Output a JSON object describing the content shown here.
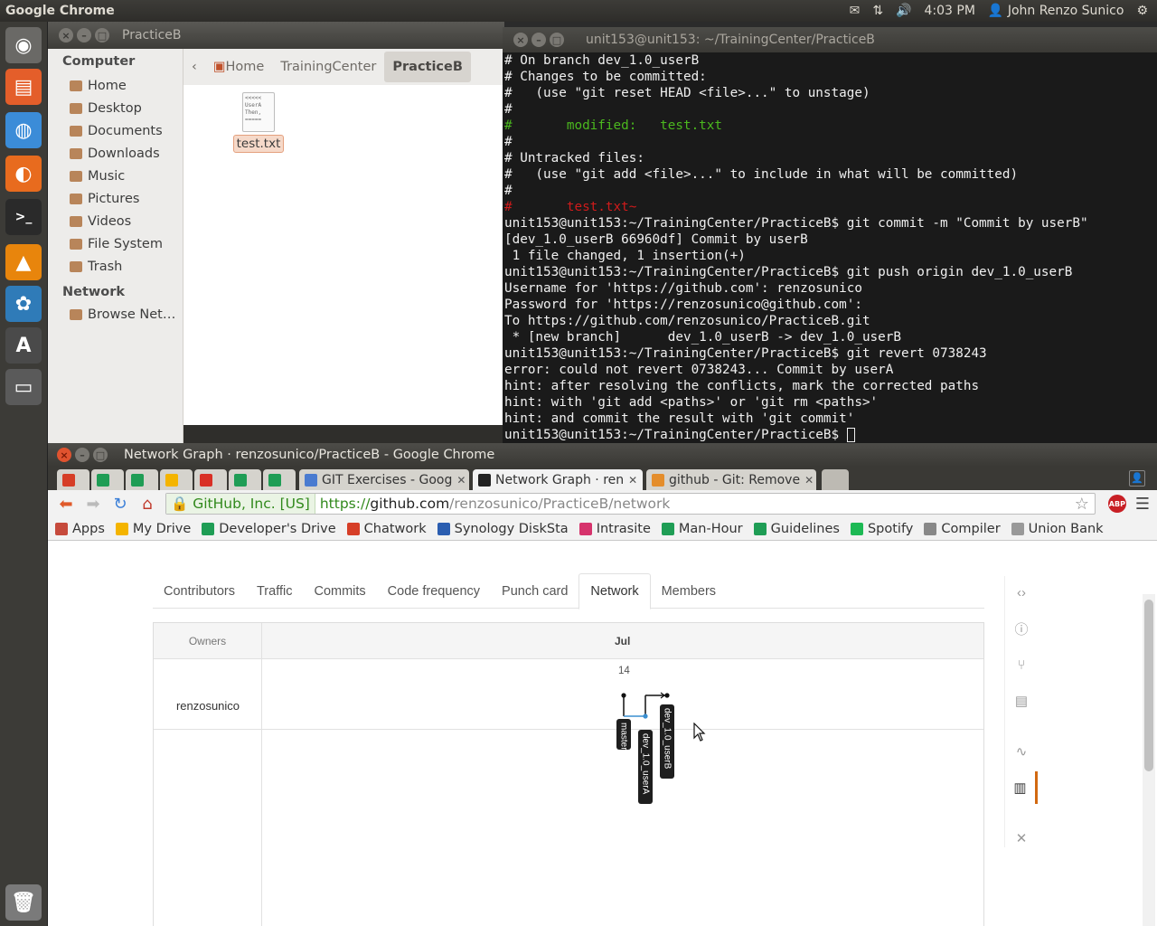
{
  "topbar": {
    "app_name": "Google Chrome",
    "time": "4:03 PM",
    "user": "John Renzo Sunico",
    "mail_icon": "✉",
    "network_icon": "⇅",
    "volume_icon": "🔊",
    "user_icon": "👤",
    "settings_icon": "⚙"
  },
  "launcher": {
    "items": [
      {
        "name": "ubuntu-dash-icon",
        "glyph": "◉",
        "color": "#6a6966"
      },
      {
        "name": "files-icon",
        "glyph": "▤",
        "color": "#e45e2a"
      },
      {
        "name": "chrome-icon",
        "glyph": "◍",
        "color": "#3b8cd8"
      },
      {
        "name": "firefox-icon",
        "glyph": "◐",
        "color": "#e86b1e"
      },
      {
        "name": "terminal-icon",
        "glyph": ">_",
        "color": "#2a2a2a"
      },
      {
        "name": "vlc-icon",
        "glyph": "▲",
        "color": "#e8850c"
      },
      {
        "name": "app-icon",
        "glyph": "✿",
        "color": "#2f7bb8"
      },
      {
        "name": "font-viewer-icon",
        "glyph": "A",
        "color": "#4a4a4a"
      },
      {
        "name": "window-icon",
        "glyph": "▭",
        "color": "#5a5a5a"
      },
      {
        "name": "trash-icon",
        "glyph": "🗑",
        "color": "#7a7a7a"
      }
    ]
  },
  "file_manager": {
    "title": "PracticeB",
    "sidebar_computer": "Computer",
    "sidebar_network": "Network",
    "places": [
      "Home",
      "Desktop",
      "Documents",
      "Downloads",
      "Music",
      "Pictures",
      "Videos",
      "File System",
      "Trash"
    ],
    "network_places": [
      "Browse Net…"
    ],
    "breadcrumbs": [
      "Home",
      "TrainingCenter",
      "PracticeB"
    ],
    "file_name": "test.txt",
    "file_preview": "<<<<<\nUserA\nThen,\n=====",
    "crumb_back": "‹"
  },
  "terminal": {
    "title": "unit153@unit153: ~/TrainingCenter/PracticeB",
    "lines": [
      {
        "text": "# On branch dev_1.0_userB",
        "cls": ""
      },
      {
        "text": "# Changes to be committed:",
        "cls": ""
      },
      {
        "text": "#   (use \"git reset HEAD <file>...\" to unstage)",
        "cls": ""
      },
      {
        "text": "#",
        "cls": ""
      },
      {
        "text": "#       modified:   test.txt",
        "cls": "grn"
      },
      {
        "text": "#",
        "cls": ""
      },
      {
        "text": "# Untracked files:",
        "cls": ""
      },
      {
        "text": "#   (use \"git add <file>...\" to include in what will be committed)",
        "cls": ""
      },
      {
        "text": "#",
        "cls": ""
      },
      {
        "text": "#       test.txt~",
        "cls": "red"
      },
      {
        "text": "unit153@unit153:~/TrainingCenter/PracticeB$ git commit -m \"Commit by userB\"",
        "cls": ""
      },
      {
        "text": "[dev_1.0_userB 66960df] Commit by userB",
        "cls": ""
      },
      {
        "text": " 1 file changed, 1 insertion(+)",
        "cls": ""
      },
      {
        "text": "unit153@unit153:~/TrainingCenter/PracticeB$ git push origin dev_1.0_userB",
        "cls": ""
      },
      {
        "text": "Username for 'https://github.com': renzosunico",
        "cls": ""
      },
      {
        "text": "Password for 'https://renzosunico@github.com':",
        "cls": ""
      },
      {
        "text": "To https://github.com/renzosunico/PracticeB.git",
        "cls": ""
      },
      {
        "text": " * [new branch]      dev_1.0_userB -> dev_1.0_userB",
        "cls": ""
      },
      {
        "text": "unit153@unit153:~/TrainingCenter/PracticeB$ git revert 0738243",
        "cls": ""
      },
      {
        "text": "error: could not revert 0738243... Commit by userA",
        "cls": ""
      },
      {
        "text": "hint: after resolving the conflicts, mark the corrected paths",
        "cls": ""
      },
      {
        "text": "hint: with 'git add <paths>' or 'git rm <paths>'",
        "cls": ""
      },
      {
        "text": "hint: and commit the result with 'git commit'",
        "cls": ""
      },
      {
        "text": "unit153@unit153:~/TrainingCenter/PracticeB$ ",
        "cls": "",
        "cursor": true
      }
    ]
  },
  "chrome": {
    "window_title": "Network Graph · renzosunico/PracticeB - Google Chrome",
    "tabs": [
      {
        "label": "",
        "icon_color": "#d63e27"
      },
      {
        "label": "",
        "icon_color": "#1f9d55"
      },
      {
        "label": "",
        "icon_color": "#1f9d55"
      },
      {
        "label": "",
        "icon_color": "#f4b400"
      },
      {
        "label": "",
        "icon_color": "#d93025"
      },
      {
        "label": "",
        "icon_color": "#1f9d55"
      },
      {
        "label": "",
        "icon_color": "#1f9d55"
      },
      {
        "label": "GIT Exercises - Goog",
        "icon_color": "#4a7bd0"
      },
      {
        "label": "Network Graph · ren",
        "icon_color": "#222222"
      },
      {
        "label": "github - Git: Remove",
        "icon_color": "#e48d2b"
      }
    ],
    "url_ev": "GitHub, Inc. [US]",
    "url_scheme": "https://",
    "url_host": "github.com",
    "url_path": "/renzosunico/PracticeB/network",
    "abp_label": "ABP",
    "bookmarks": [
      {
        "label": "Apps",
        "color": "#c64a3c"
      },
      {
        "label": "My Drive",
        "color": "#f4b400"
      },
      {
        "label": "Developer's Drive",
        "color": "#1f9d55"
      },
      {
        "label": "Chatwork",
        "color": "#d63e27"
      },
      {
        "label": "Synology DiskSta",
        "color": "#2a5db0"
      },
      {
        "label": "Intrasite",
        "color": "#d6336c"
      },
      {
        "label": "Man-Hour",
        "color": "#1f9d55"
      },
      {
        "label": "Guidelines",
        "color": "#1f9d55"
      },
      {
        "label": "Spotify",
        "color": "#1db954"
      },
      {
        "label": "Compiler",
        "color": "#888888"
      },
      {
        "label": "Union Bank",
        "color": "#999999"
      }
    ]
  },
  "github": {
    "tabs": [
      "Contributors",
      "Traffic",
      "Commits",
      "Code frequency",
      "Punch card",
      "Network",
      "Members"
    ],
    "active_tab": "Network",
    "owners_header": "Owners",
    "month": "Jul",
    "day": "14",
    "owner": "renzosunico",
    "sidenav_icons": [
      "code-icon",
      "issues-icon",
      "pull-request-icon",
      "wiki-icon",
      "pulse-icon",
      "graphs-icon",
      "settings-icon"
    ],
    "sidenav_glyphs": [
      "‹›",
      "ⓘ",
      "⑂",
      "▤",
      "∿",
      "▥",
      "✕"
    ]
  },
  "chart_data": {
    "type": "network-graph",
    "month": "Jul",
    "day": "14",
    "owner": "renzosunico",
    "branches": [
      "master",
      "dev_1.0_userA",
      "dev_1.0_userB"
    ]
  }
}
